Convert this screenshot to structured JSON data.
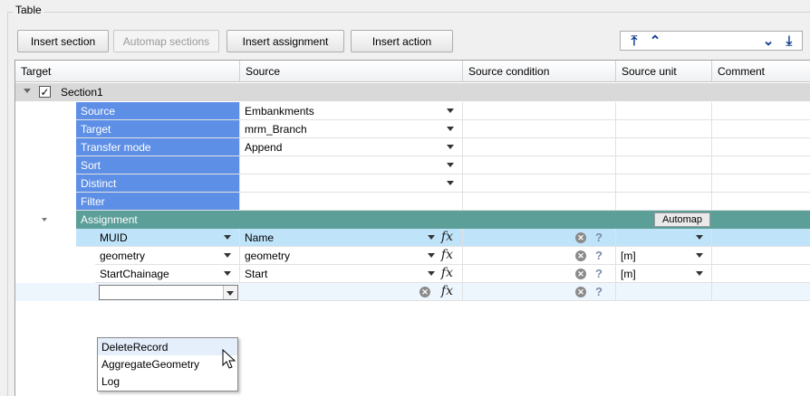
{
  "group": {
    "title": "Table"
  },
  "toolbar": {
    "insert_section": "Insert section",
    "automap_sections": "Automap sections",
    "insert_assignment": "Insert assignment",
    "insert_action": "Insert action"
  },
  "columns": [
    "Target",
    "Source",
    "Source condition",
    "Source unit",
    "Comment"
  ],
  "section": {
    "label": "Section1",
    "checked": true
  },
  "properties": [
    {
      "name": "Source",
      "value": "Embankments",
      "dropdown": true
    },
    {
      "name": "Target",
      "value": "mrm_Branch",
      "dropdown": true
    },
    {
      "name": "Transfer mode",
      "value": "Append",
      "dropdown": true
    },
    {
      "name": "Sort",
      "value": "",
      "dropdown": true
    },
    {
      "name": "Distinct",
      "value": "",
      "dropdown": true
    },
    {
      "name": "Filter",
      "value": "",
      "dropdown": false
    }
  ],
  "assignment": {
    "label": "Assignment",
    "automap": "Automap"
  },
  "assignments": [
    {
      "target": "MUID",
      "source": "Name",
      "unit": ""
    },
    {
      "target": "geometry",
      "source": "geometry",
      "unit": ""
    },
    {
      "target": "StartChainage",
      "source": "Start",
      "unit": ""
    }
  ],
  "units": [
    "",
    "[m]",
    "[m]"
  ],
  "dropdown_options": [
    "DeleteRecord",
    "AggregateGeometry",
    "Log"
  ],
  "colors": {
    "property": "#5e8fe6",
    "assignment": "#5c9e98",
    "selected": "#bfe4fa",
    "section": "#d9d9d9"
  }
}
